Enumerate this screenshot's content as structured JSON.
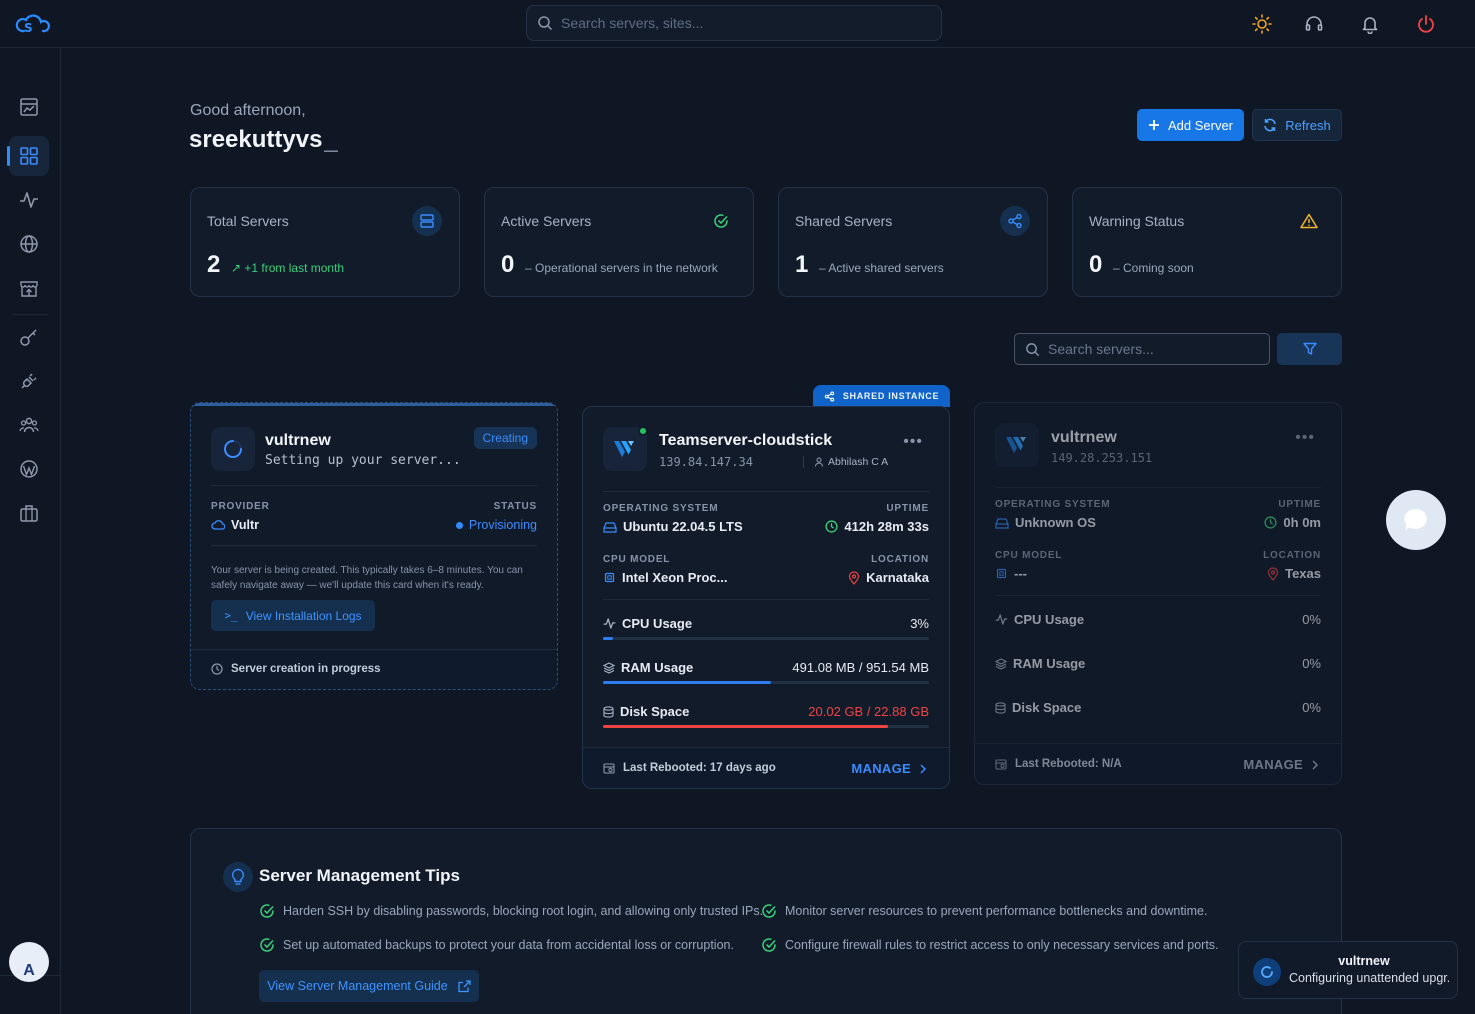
{
  "header": {
    "search_placeholder": "Search servers, sites..."
  },
  "greeting": {
    "salutation": "Good afternoon,",
    "username": "sreekuttyvs",
    "cursor": "_"
  },
  "actions": {
    "add_server": "Add Server",
    "refresh": "Refresh"
  },
  "stats": [
    {
      "label": "Total Servers",
      "value": "2",
      "sub": "+1 from last month",
      "icon": "server-icon"
    },
    {
      "label": "Active Servers",
      "value": "0",
      "sub": "– Operational servers in the network",
      "icon": "check-circle-icon"
    },
    {
      "label": "Shared Servers",
      "value": "1",
      "sub": "– Active shared servers",
      "icon": "share-icon"
    },
    {
      "label": "Warning Status",
      "value": "0",
      "sub": "– Coming soon",
      "icon": "warning-icon"
    }
  ],
  "server_search_placeholder": "Search servers...",
  "cards": {
    "creating": {
      "name": "vultrnew",
      "subtitle": "Setting up your server...",
      "badge": "Creating",
      "provider_label": "PROVIDER",
      "provider": "Vultr",
      "status_label": "STATUS",
      "status": "Provisioning",
      "note": "Your server is being created. This typically takes 6–8 minutes. You can safely navigate away — we'll update this card when it's ready.",
      "logs_button": "View Installation Logs",
      "footer": "Server creation in progress"
    },
    "shared": {
      "tag": "SHARED INSTANCE",
      "name": "Teamserver-cloudstick",
      "ip": "139.84.147.34",
      "owner": "Abhilash C A",
      "os_label": "OPERATING SYSTEM",
      "os": "Ubuntu 22.04.5 LTS",
      "uptime_label": "UPTIME",
      "uptime": "412h 28m 33s",
      "cpu_model_label": "CPU MODEL",
      "cpu_model": "Intel Xeon Proc...",
      "location_label": "LOCATION",
      "location": "Karnataka",
      "cpu_label": "CPU Usage",
      "cpu_value": "3%",
      "cpu_fraction": 0.03,
      "ram_label": "RAM Usage",
      "ram_value": "491.08 MB / 951.54 MB",
      "ram_fraction": 0.516,
      "disk_label": "Disk Space",
      "disk_value": "20.02 GB / 22.88 GB",
      "disk_fraction": 0.875,
      "last_rebooted": "Last Rebooted: 17 days ago",
      "manage": "MANAGE"
    },
    "inactive": {
      "name": "vultrnew",
      "ip": "149.28.253.151",
      "os_label": "OPERATING SYSTEM",
      "os": "Unknown OS",
      "uptime_label": "UPTIME",
      "uptime": "0h 0m",
      "cpu_model_label": "CPU MODEL",
      "cpu_model": "---",
      "location_label": "LOCATION",
      "location": "Texas",
      "cpu_label": "CPU Usage",
      "cpu_value": "0%",
      "ram_label": "RAM Usage",
      "ram_value": "0%",
      "disk_label": "Disk Space",
      "disk_value": "0%",
      "last_rebooted": "Last Rebooted: N/A",
      "manage": "MANAGE"
    }
  },
  "tips": {
    "title": "Server Management Tips",
    "items": [
      "Harden SSH by disabling passwords, blocking root login, and allowing only trusted IPs.",
      "Monitor server resources to prevent performance bottlenecks and downtime.",
      "Set up automated backups to protect your data from accidental loss or corruption.",
      "Configure firewall rules to restrict access to only necessary services and ports."
    ],
    "guide_button": "View Server Management Guide"
  },
  "toast": {
    "title": "vultrnew",
    "message": "Configuring unattended upgr..."
  },
  "avatar_initial": "A",
  "colors": {
    "accent": "#1877e6",
    "success": "#3ad17a",
    "warning": "#f0b429",
    "danger": "#ef4444"
  }
}
